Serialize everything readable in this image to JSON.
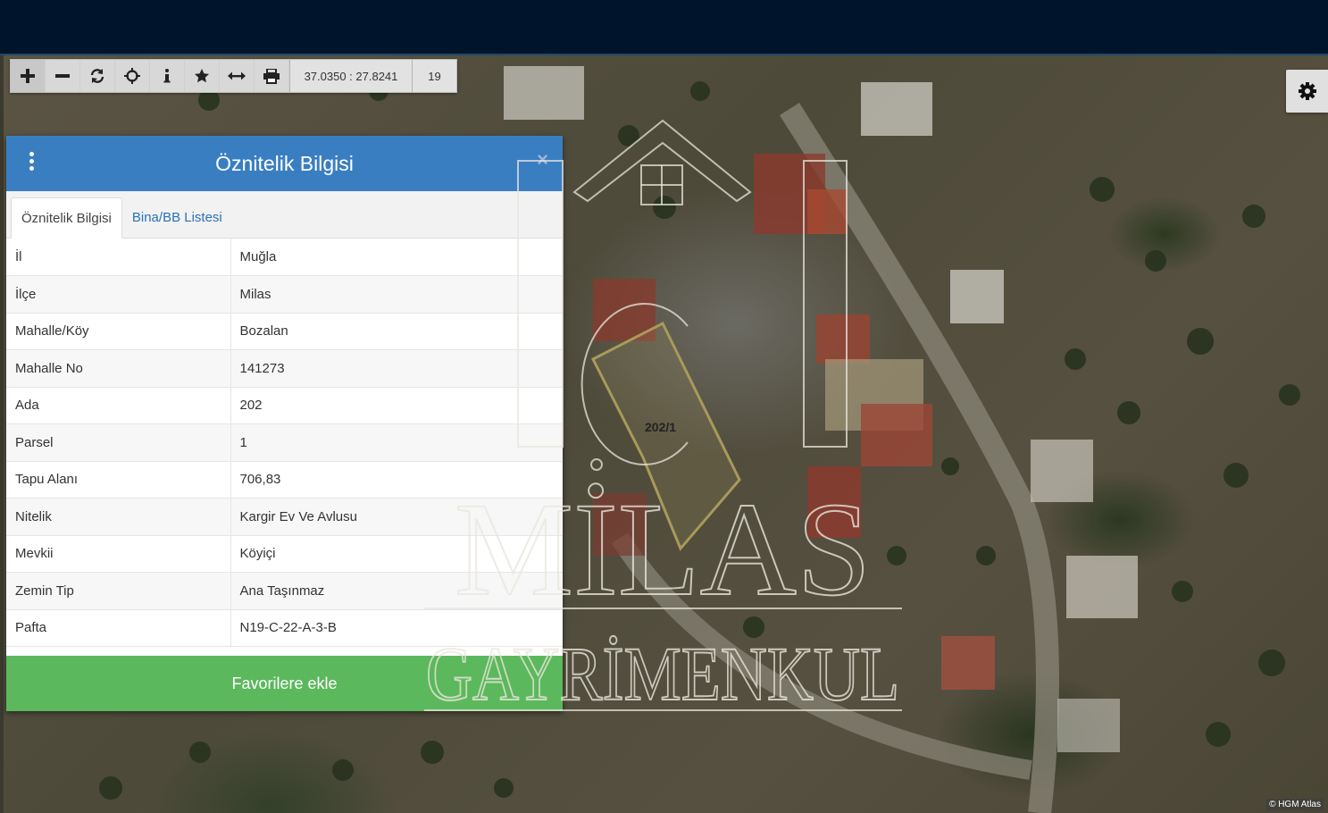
{
  "toolbar": {
    "zoom_in_icon": "plus-icon",
    "zoom_out_icon": "minus-icon",
    "refresh_icon": "refresh-icon",
    "locate_icon": "crosshair-icon",
    "info_icon": "info-icon",
    "favorite_icon": "star-icon",
    "measure_icon": "arrows-horizontal-icon",
    "print_icon": "printer-icon",
    "coordinates": "37.0350 : 27.8241",
    "zoom_level": "19"
  },
  "panel": {
    "title": "Öznitelik Bilgisi",
    "tabs": [
      {
        "label": "Öznitelik Bilgisi"
      },
      {
        "label": "Bina/BB Listesi"
      }
    ],
    "rows": [
      {
        "key": "İl",
        "value": "Muğla"
      },
      {
        "key": "İlçe",
        "value": "Milas"
      },
      {
        "key": "Mahalle/Köy",
        "value": "Bozalan"
      },
      {
        "key": "Mahalle No",
        "value": "141273"
      },
      {
        "key": "Ada",
        "value": "202"
      },
      {
        "key": "Parsel",
        "value": "1"
      },
      {
        "key": "Tapu Alanı",
        "value": "706,83"
      },
      {
        "key": "Nitelik",
        "value": "Kargir Ev Ve Avlusu"
      },
      {
        "key": "Mevkii",
        "value": "Köyiçi"
      },
      {
        "key": "Zemin Tip",
        "value": "Ana Taşınmaz"
      },
      {
        "key": "Pafta",
        "value": "N19-C-22-A-3-B"
      }
    ],
    "favorite_button": "Favorilere ekle"
  },
  "map": {
    "parcel_label": "202/1",
    "attribution": "© HGM Atlas"
  },
  "watermark": {
    "line1": "MİLAS",
    "line2": "GAYRİMENKUL"
  },
  "colors": {
    "header": "#3a7ec2",
    "favorite": "#5cb85c",
    "topbar": "#00152b"
  }
}
